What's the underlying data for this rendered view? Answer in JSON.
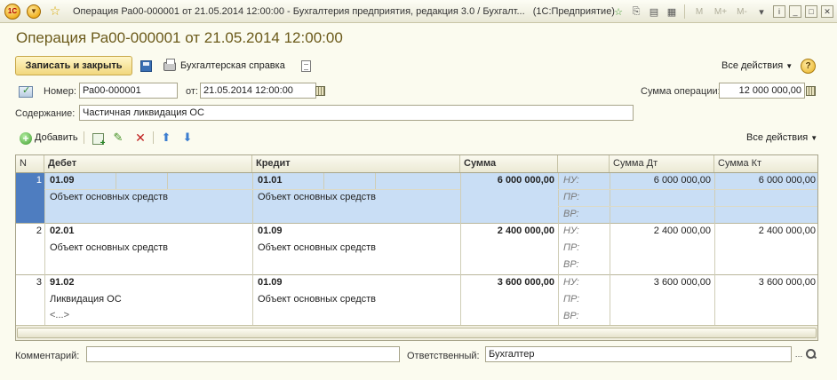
{
  "window": {
    "title": "Операция Ра00-000001 от 21.05.2014 12:00:00 - Бухгалтерия предприятия, редакция 3.0 / Бухгалт...",
    "app": "(1С:Предприятие)",
    "logo": "1С",
    "right_buttons": [
      "M",
      "M+",
      "M-"
    ]
  },
  "form": {
    "title": "Операция Ра00-000001 от 21.05.2014 12:00:00",
    "toolbar": {
      "save_close_label": "Записать и закрыть",
      "report_label": "Бухгалтерская справка",
      "all_actions_label": "Все действия",
      "help_label": "?"
    },
    "fields": {
      "number_label": "Номер:",
      "number_value": "Ра00-000001",
      "date_label": "от:",
      "date_value": "21.05.2014 12:00:00",
      "amount_label": "Сумма операции:",
      "amount_value": "12 000 000,00",
      "content_label": "Содержание:",
      "content_value": "Частичная ликвидация ОС"
    },
    "table_toolbar": {
      "add_label": "Добавить",
      "all_actions_label": "Все действия"
    },
    "table": {
      "headers": {
        "n": "N",
        "debit": "Дебет",
        "credit": "Кредит",
        "sum": "Сумма",
        "sum_dt": "Сумма Дт",
        "sum_kt": "Сумма Кт"
      },
      "type_labels": [
        "НУ:",
        "ПР:",
        "ВР:"
      ],
      "rows": [
        {
          "n": "1",
          "debit_account": "01.09",
          "debit_sub1": "Объект основных средств",
          "debit_sub2": "",
          "credit_account": "01.01",
          "credit_sub1": "Объект основных средств",
          "sum": "6 000 000,00",
          "sum_dt": "6 000 000,00",
          "sum_kt": "6 000 000,00"
        },
        {
          "n": "2",
          "debit_account": "02.01",
          "debit_sub1": "Объект основных средств",
          "debit_sub2": "",
          "credit_account": "01.09",
          "credit_sub1": "Объект основных средств",
          "sum": "2 400 000,00",
          "sum_dt": "2 400 000,00",
          "sum_kt": "2 400 000,00"
        },
        {
          "n": "3",
          "debit_account": "91.02",
          "debit_sub1": "Ликвидация ОС",
          "debit_sub2": "<...>",
          "credit_account": "01.09",
          "credit_sub1": "Объект основных средств",
          "sum": "3 600 000,00",
          "sum_dt": "3 600 000,00",
          "sum_kt": "3 600 000,00"
        }
      ]
    },
    "bottom": {
      "comment_label": "Комментарий:",
      "comment_value": "",
      "responsible_label": "Ответственный:",
      "responsible_value": "Бухгалтер"
    }
  }
}
